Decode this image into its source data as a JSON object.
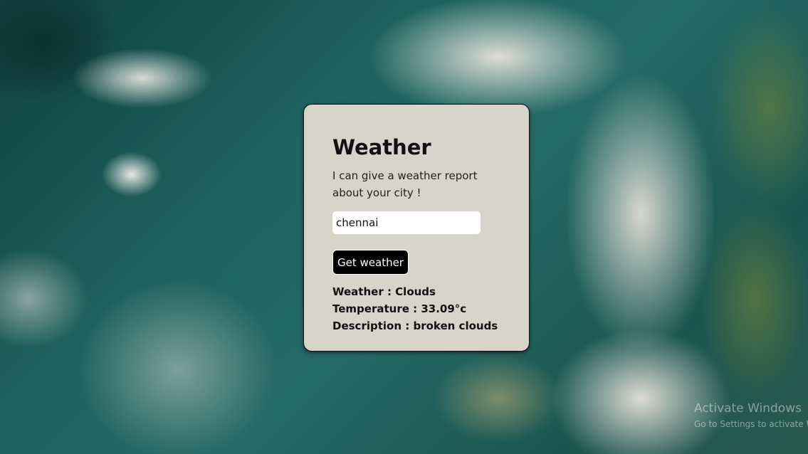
{
  "card": {
    "title": "Weather",
    "subtitle": "I can give a weather report about your city !",
    "city_input": {
      "value": "chennai",
      "placeholder": ""
    },
    "button_label": "Get weather",
    "results": {
      "weather": "Weather : Clouds",
      "temperature": "Temperature : 33.09°c",
      "description": "Description : broken clouds"
    }
  },
  "watermark": {
    "title": "Activate Windows",
    "subtitle": "Go to Settings to activate Windows."
  },
  "colors": {
    "card_background": "#d7d4c9",
    "button_background": "#000000",
    "button_text": "#ffffff"
  }
}
